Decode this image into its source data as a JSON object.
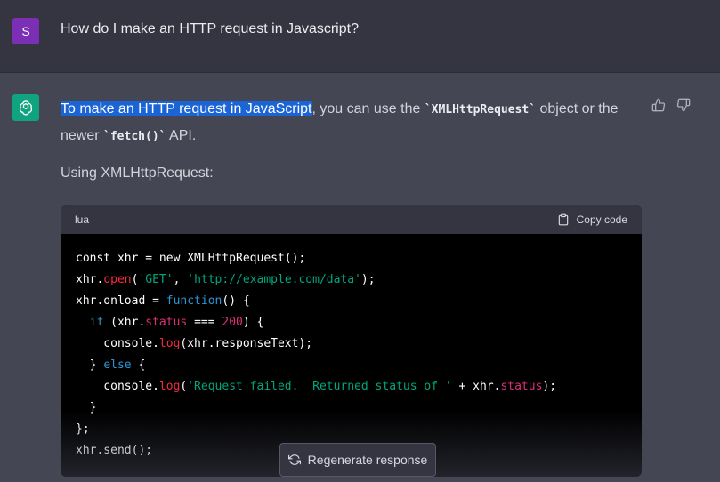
{
  "user": {
    "avatar_letter": "S",
    "avatar_color": "#7b2fb5",
    "message": "How do I make an HTTP request in Javascript?"
  },
  "assistant": {
    "avatar_color": "#10a37f",
    "para1_highlight": "To make an HTTP request in JavaScript",
    "para1_mid": ", you can use the ",
    "para1_code1": "`XMLHttpRequest`",
    "para1_after_code1": " object or the newer ",
    "para1_code2": "`fetch()`",
    "para1_end": " API.",
    "subheading": "Using XMLHttpRequest:",
    "code_block": {
      "language": "lua",
      "copy_label": "Copy code"
    },
    "feedback": [
      "thumbs-up-icon",
      "thumbs-down-icon"
    ]
  },
  "code": {
    "l1": "const xhr = new XMLHttpRequest();",
    "l2a": "xhr.",
    "l2_open": "open",
    "l2b": "(",
    "l2_get": "'GET'",
    "l2c": ", ",
    "l2_url": "'http://example.com/data'",
    "l2d": ");",
    "l3a": "xhr.onload = ",
    "l3_function": "function",
    "l3b": "() {",
    "l4_indent": "  ",
    "l4_if": "if",
    "l4a": " (xhr.",
    "l4_status": "status",
    "l4b": " === ",
    "l4_200": "200",
    "l4c": ") {",
    "l5a": "    console.",
    "l5_log": "log",
    "l5b": "(xhr.responseText);",
    "l6a": "  } ",
    "l6_else": "else",
    "l6b": " {",
    "l7a": "    console.",
    "l7_log": "log",
    "l7b": "(",
    "l7_str": "'Request failed.  Returned status of '",
    "l7c": " + xhr.",
    "l7_status": "status",
    "l7d": ");",
    "l8": "  }",
    "l9": "};",
    "l10": "xhr.send();"
  },
  "regenerate": {
    "label": "Regenerate response",
    "icon": "refresh-icon"
  }
}
